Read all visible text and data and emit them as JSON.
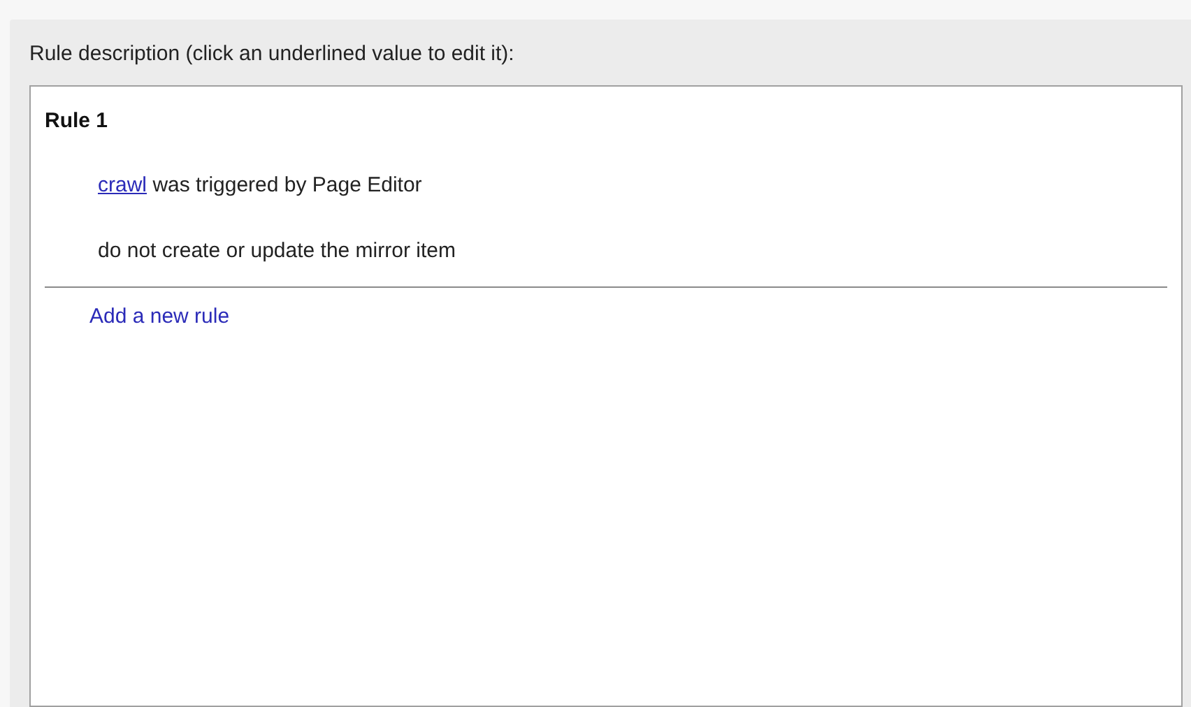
{
  "panel": {
    "label": "Rule description (click an underlined value to edit it):"
  },
  "rules": [
    {
      "title": "Rule 1",
      "lines": [
        {
          "kind": "condition",
          "link": "crawl",
          "text": "was triggered by Page Editor"
        },
        {
          "kind": "action",
          "text": "do not create or update the mirror item"
        }
      ]
    }
  ],
  "add_rule_link": "Add a new rule"
}
